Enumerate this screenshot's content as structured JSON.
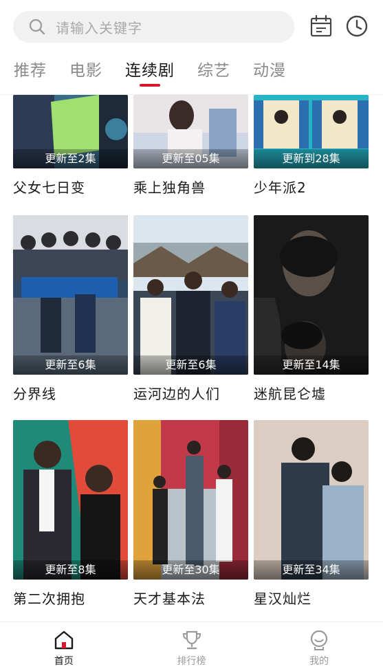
{
  "search": {
    "placeholder": "请输入关键字"
  },
  "header": {
    "calendar_icon": "calendar-icon",
    "history_icon": "clock-icon"
  },
  "tabs": [
    {
      "label": "推荐",
      "active": false
    },
    {
      "label": "电影",
      "active": false
    },
    {
      "label": "连续剧",
      "active": true
    },
    {
      "label": "综艺",
      "active": false
    },
    {
      "label": "动漫",
      "active": false
    }
  ],
  "shows": [
    {
      "title": "父女七日变",
      "update": "更新至2集"
    },
    {
      "title": "乘上独角兽",
      "update": "更新至05集"
    },
    {
      "title": "少年派2",
      "update": "更新到28集"
    },
    {
      "title": "分界线",
      "update": "更新至6集"
    },
    {
      "title": "运河边的人们",
      "update": "更新至6集"
    },
    {
      "title": "迷航昆仑墟",
      "update": "更新至14集"
    },
    {
      "title": "第二次拥抱",
      "update": "更新至8集"
    },
    {
      "title": "天才基本法",
      "update": "更新至30集"
    },
    {
      "title": "星汉灿烂",
      "update": "更新至34集"
    }
  ],
  "bottom_nav": [
    {
      "label": "首页",
      "icon": "home-icon",
      "active": true
    },
    {
      "label": "排行榜",
      "icon": "trophy-icon",
      "active": false
    },
    {
      "label": "我的",
      "icon": "profile-icon",
      "active": false
    }
  ],
  "colors": {
    "accent": "#d7182a",
    "text": "#1a1a1a",
    "muted": "#8a8a8a"
  }
}
